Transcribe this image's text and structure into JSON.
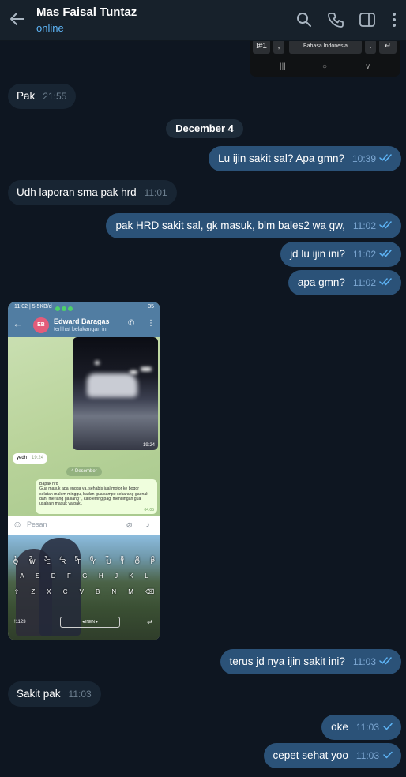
{
  "header": {
    "title": "Mas Faisal Tuntaz",
    "status": "online",
    "icons": [
      "back-arrow-icon",
      "search-icon",
      "phone-icon",
      "sidebar-icon",
      "more-vertical-icon"
    ]
  },
  "top_keyboard_fragment": {
    "keys": [
      "!#1",
      ",",
      "Bahasa Indonesia",
      ".",
      "↵"
    ],
    "nav": [
      "|||",
      "○",
      "∨"
    ]
  },
  "messages": [
    {
      "dir": "in",
      "text": "Pak",
      "time": "21:55"
    },
    {
      "dir": "out",
      "text": "Lu ijin sakit sal? Apa gmn?",
      "time": "10:39",
      "status": "read"
    },
    {
      "dir": "in",
      "text": "Udh laporan sma pak hrd",
      "time": "11:01"
    },
    {
      "dir": "out",
      "text": "pak HRD sakit sal, gk masuk, blm bales2 wa gw,",
      "time": "11:02",
      "status": "read"
    },
    {
      "dir": "out",
      "text": "jd lu ijin ini?",
      "time": "11:02",
      "status": "read"
    },
    {
      "dir": "out",
      "text": "apa gmn?",
      "time": "11:02",
      "status": "read"
    },
    {
      "dir": "out",
      "text": "terus jd nya ijin sakit ini?",
      "time": "11:03",
      "status": "read"
    },
    {
      "dir": "in",
      "text": "Sakit pak",
      "time": "11:03"
    },
    {
      "dir": "out",
      "text": "oke",
      "time": "11:03",
      "status": "sent"
    },
    {
      "dir": "out",
      "text": "cepet sehat yoo",
      "time": "11:03",
      "status": "sent"
    }
  ],
  "date_separator": "December 4",
  "screenshot": {
    "status_bar_time": "11:02 | 5,5KB/d",
    "status_bar_battery": "35",
    "contact_initials": "EB",
    "contact_name": "Edward Baragas",
    "contact_status": "terlihat belakangan ini",
    "photo_time": "19:24",
    "reply_text": "yedh",
    "reply_time": "19:24",
    "date_chip": "4 Desember",
    "long_message": "Bapak hrd\nGua masuk apa engga ya, sehabis jual motor ke bogor selatan malem minggu, badan gua sampe sekarang gaenak dah, meriang ga ilang\" , kalo emng pagi mendingan gua usahain masuk ya pak..",
    "long_message_time": "04:05",
    "input_placeholder": "Pesan",
    "keyboard_rows": [
      [
        "1",
        "2",
        "3",
        "4",
        "5",
        "6",
        "7",
        "8",
        "9",
        "0"
      ],
      [
        "Q",
        "W",
        "E",
        "R",
        "T",
        "Y",
        "U",
        "I",
        "O",
        "P"
      ],
      [
        "A",
        "S",
        "D",
        "F",
        "G",
        "H",
        "J",
        "K",
        "L"
      ],
      [
        "⇧",
        "Z",
        "X",
        "C",
        "V",
        "B",
        "N",
        "M",
        "⌫"
      ]
    ],
    "keyboard_bottom": {
      "left": "!1123",
      "space": "◂ INEN ▸",
      "right": "↵"
    }
  }
}
